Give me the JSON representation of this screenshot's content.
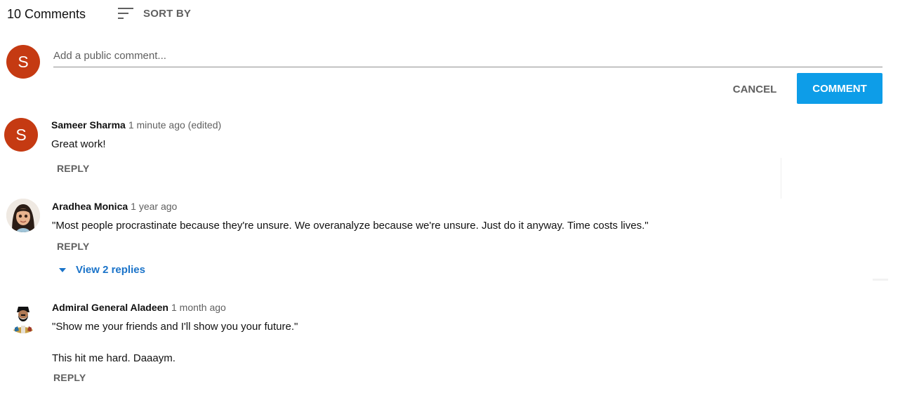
{
  "header": {
    "comment_count": "10 Comments",
    "sort_label": "SORT BY",
    "sort_icon": "sort-icon"
  },
  "composer": {
    "avatar_letter": "S",
    "placeholder": "Add a public comment...",
    "value": "",
    "cancel_label": "CANCEL",
    "submit_label": "COMMENT"
  },
  "comments": [
    {
      "avatar_letter": "S",
      "author": "Sameer Sharma",
      "time": "1 minute ago (edited)",
      "text": [
        "Great work!"
      ],
      "reply_label": "REPLY"
    },
    {
      "author": "Aradhea Monica",
      "time": "1 year ago",
      "text": [
        "\"Most people procrastinate because they're unsure. We overanalyze because we're unsure. Just do it anyway. Time costs lives.\""
      ],
      "reply_label": "REPLY",
      "view_replies_label": "View 2 replies"
    },
    {
      "author": "Admiral General Aladeen",
      "time": "1 month ago",
      "text": [
        "\"Show me your friends and I'll show you your future.\"",
        "This hit me hard. Daaaym."
      ],
      "reply_label": "REPLY"
    }
  ],
  "colors": {
    "accent": "#0d9de8",
    "link": "#1a73c9",
    "avatar": "#c53a12",
    "muted": "#606060"
  }
}
